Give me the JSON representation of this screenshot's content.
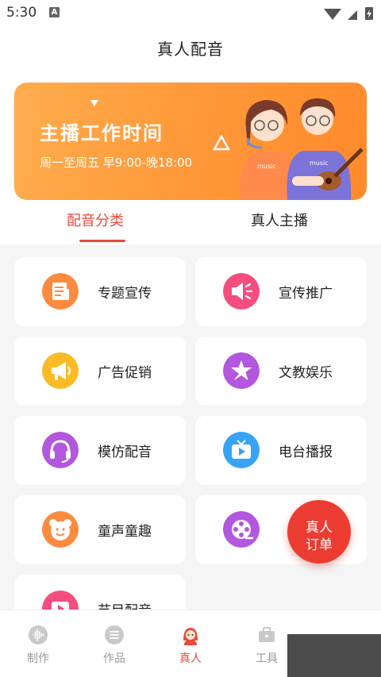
{
  "status_bar": {
    "time": "5:30"
  },
  "header": {
    "title": "真人配音"
  },
  "banner": {
    "title": "主播工作时间",
    "subtitle": "周一至周五 早9:00-晚18:00"
  },
  "tabs": [
    {
      "label": "配音分类",
      "active": true
    },
    {
      "label": "真人主播",
      "active": false
    }
  ],
  "categories": [
    {
      "label": "专题宣传",
      "icon": "document-icon",
      "color": "#fb8c3f"
    },
    {
      "label": "宣传推广",
      "icon": "megaphone-icon",
      "color": "#f54d7d"
    },
    {
      "label": "广告促销",
      "icon": "bullhorn-icon",
      "color": "#fbbb25"
    },
    {
      "label": "文教娱乐",
      "icon": "star-icon",
      "color": "#b257de"
    },
    {
      "label": "模仿配音",
      "icon": "headset-icon",
      "color": "#b257de"
    },
    {
      "label": "电台播报",
      "icon": "tv-icon",
      "color": "#36a3f6"
    },
    {
      "label": "童声童趣",
      "icon": "bear-icon",
      "color": "#fb8c3f"
    },
    {
      "label": "",
      "icon": "film-reel-icon",
      "color": "#b257de"
    },
    {
      "label": "节目配音",
      "icon": "video-icon",
      "color": "#f54d7d"
    }
  ],
  "fab": {
    "line1": "真人",
    "line2": "订单"
  },
  "bottom_nav": [
    {
      "label": "制作",
      "icon": "waveform-icon",
      "active": false
    },
    {
      "label": "作品",
      "icon": "list-icon",
      "active": false
    },
    {
      "label": "真人",
      "icon": "person-icon",
      "active": true
    },
    {
      "label": "工具",
      "icon": "toolbox-icon",
      "active": false
    }
  ],
  "colors": {
    "accent": "#e84a3c",
    "banner": "#ff9a3a"
  }
}
